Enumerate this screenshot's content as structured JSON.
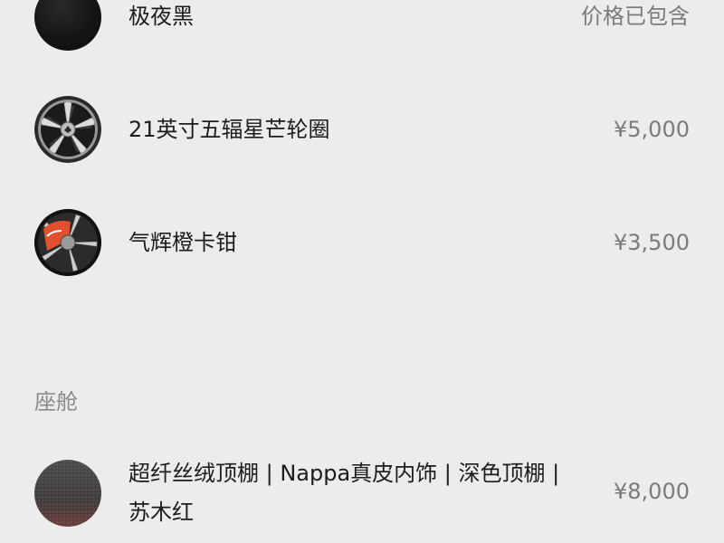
{
  "exterior": {
    "paint": {
      "label": "极夜黑",
      "price": "价格已包含",
      "icon": "paint-swatch-black"
    },
    "wheel": {
      "label": "21英寸五辐星芒轮圈",
      "price": "¥5,000",
      "icon": "wheel-thumbnail"
    },
    "caliper": {
      "label": "气辉橙卡钳",
      "price": "¥3,500",
      "icon": "orange-caliper-thumbnail",
      "accent": "#e2512d"
    }
  },
  "cabin": {
    "section_title": "座舱",
    "interior": {
      "label_line1": "超纤丝绒顶棚 | Nappa真皮内饰 | 深色顶棚 |",
      "label_line2": "苏木红",
      "price": "¥8,000",
      "icon": "interior-swatch-sumu-red"
    }
  },
  "colors": {
    "background": "#ececec",
    "text_primary": "#1c1c1c",
    "text_secondary": "#7b7b7b",
    "section_title": "#8a8a8a"
  }
}
